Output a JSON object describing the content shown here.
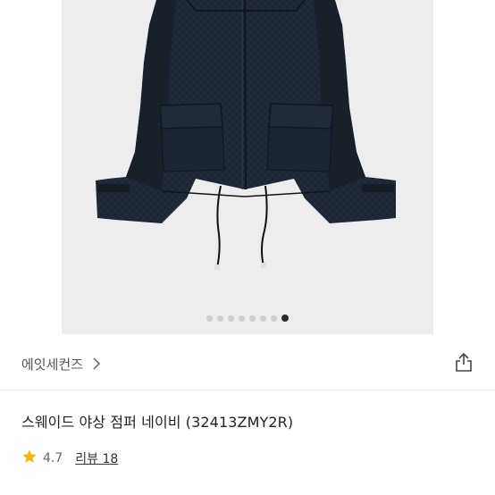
{
  "gallery": {
    "image_alt": "navy suede field jacket",
    "slide_count": 8,
    "active_index": 7
  },
  "brand": {
    "name": "에잇세컨즈",
    "chevron_icon": "chevron-right-icon",
    "share_icon": "share-icon"
  },
  "product": {
    "title": "스웨이드 야상 점퍼 네이비 (32413ZMY2R)"
  },
  "rating": {
    "star_icon": "star-icon",
    "star_color": "#f5b400",
    "score": "4.7",
    "reviews_label": "리뷰 18"
  }
}
